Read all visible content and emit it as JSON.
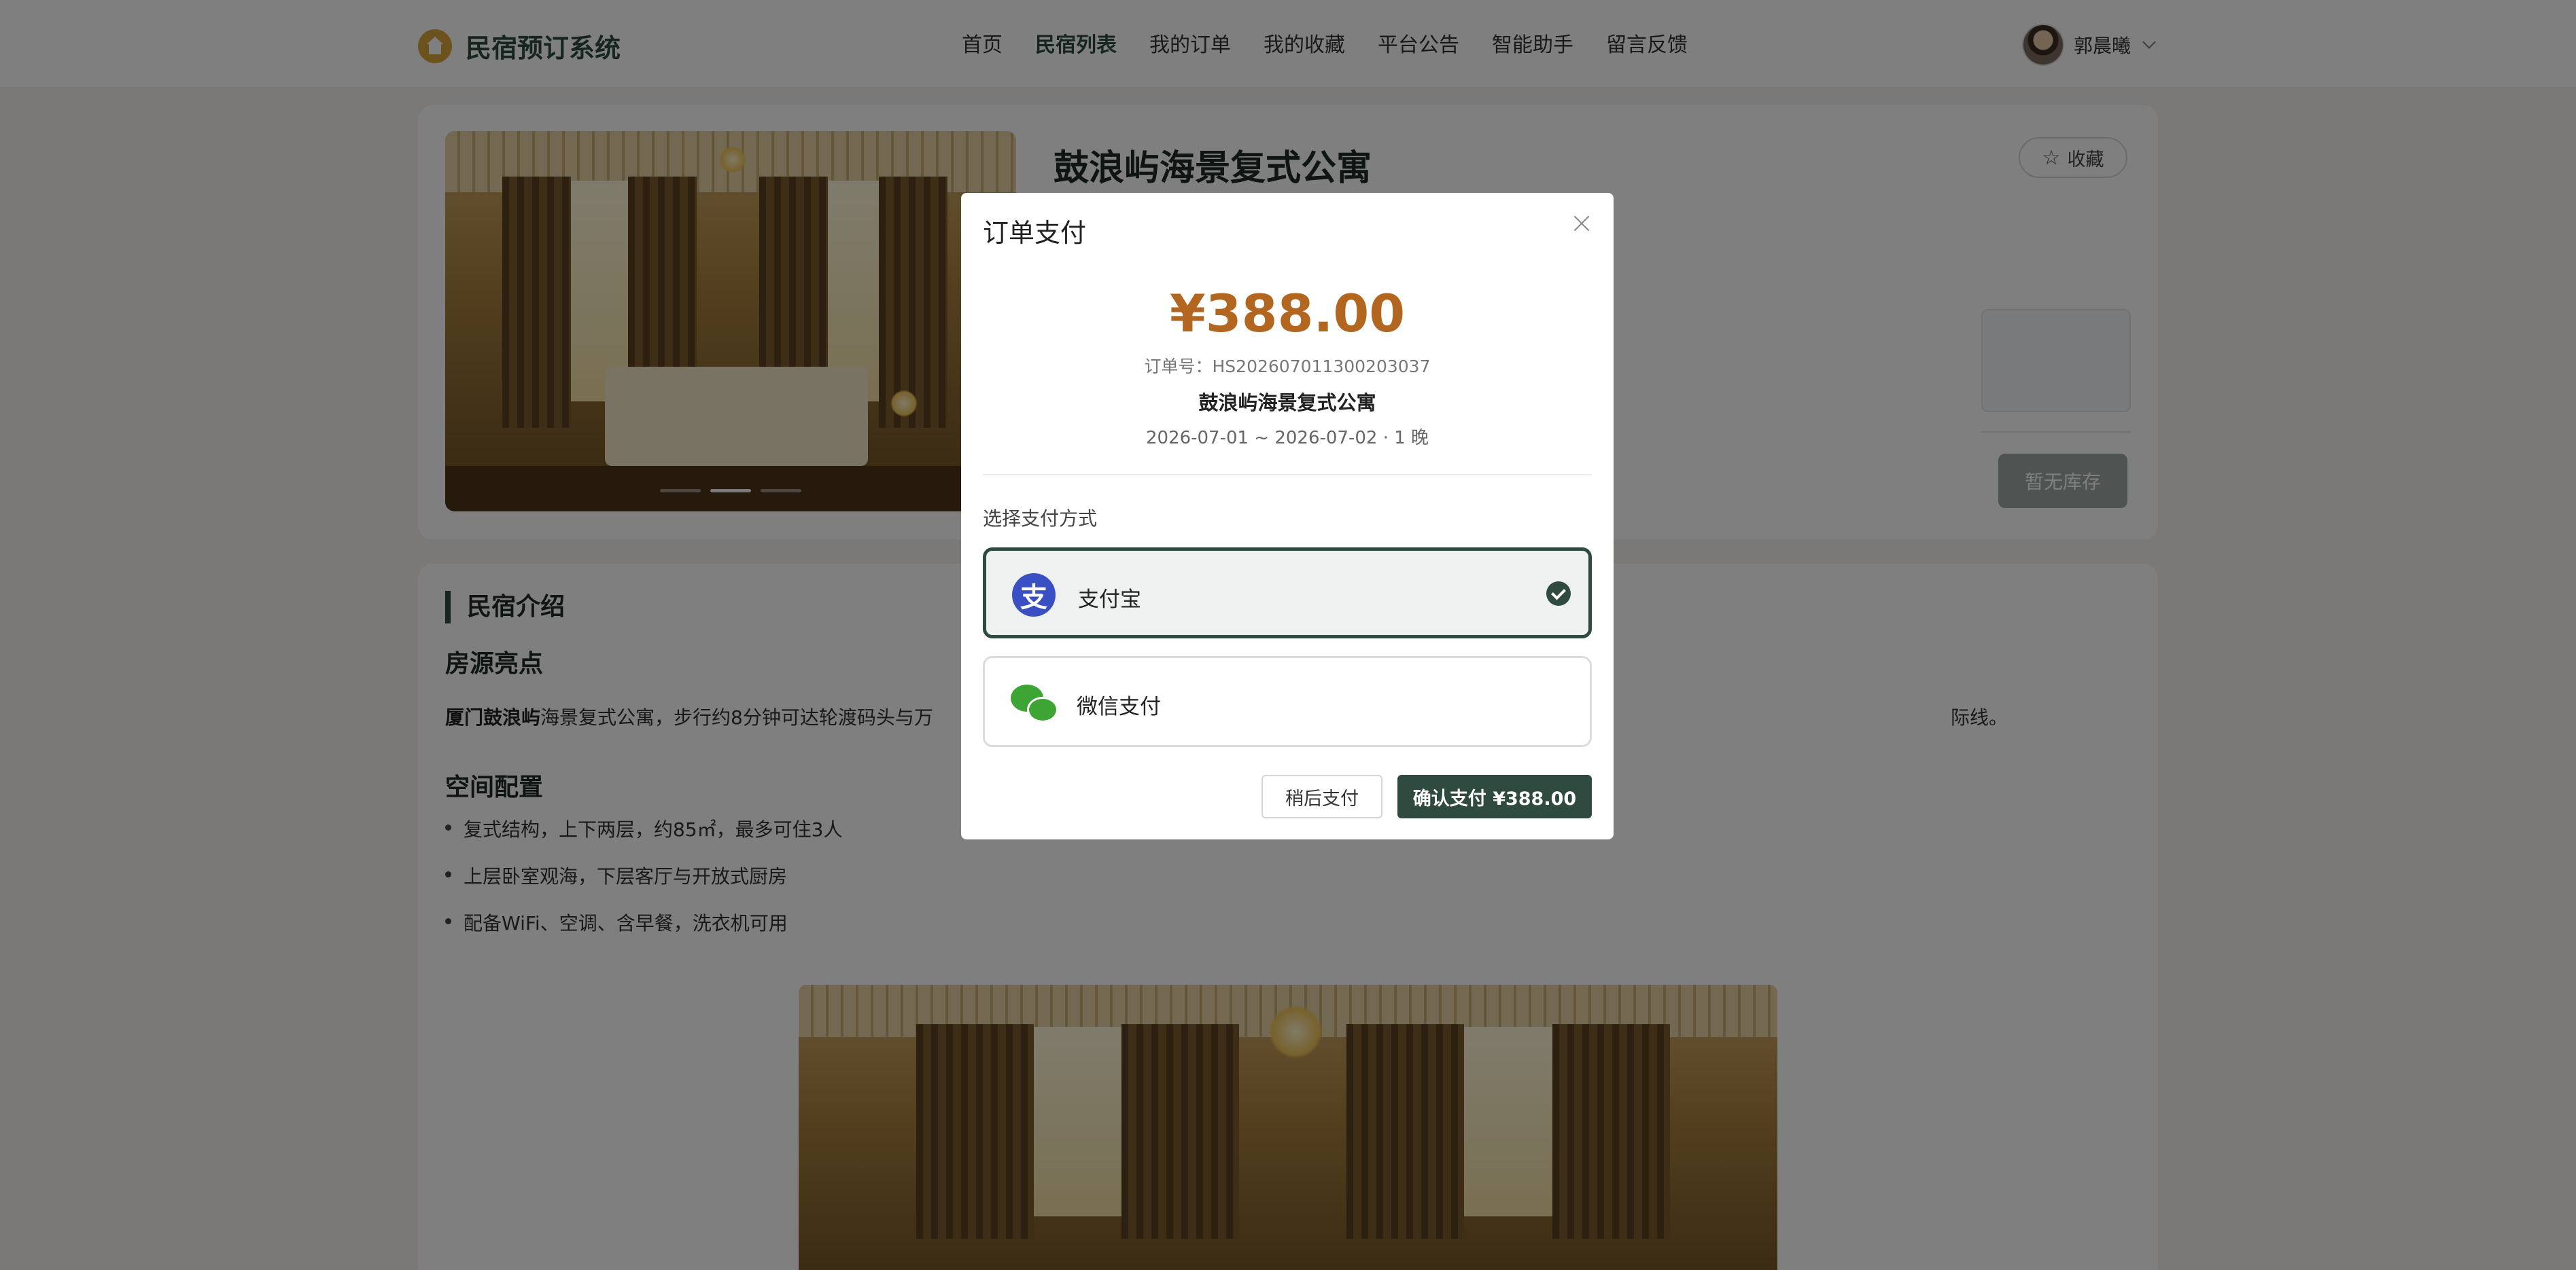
{
  "header": {
    "brand": "民宿预订系统",
    "nav": [
      "首页",
      "民宿列表",
      "我的订单",
      "我的收藏",
      "平台公告",
      "智能助手",
      "留言反馈"
    ],
    "active_nav": "民宿列表",
    "user_name": "郭晨曦"
  },
  "detail": {
    "title": "鼓浪屿海景复式公寓",
    "fav_label": "收藏",
    "stock_button": "暂无库存"
  },
  "intro": {
    "section_title": "民宿介绍",
    "highlight_title": "房源亮点",
    "para_bold": "厦门鼓浪屿",
    "para_rest": "海景复式公寓，步行约8分钟可达轮渡码头与万",
    "para_tail": "际线。",
    "space_title": "空间配置",
    "bullets": [
      "复式结构，上下两层，约85㎡，最多可住3人",
      "上层卧室观海，下层客厅与开放式厨房",
      "配备WiFi、空调、含早餐，洗衣机可用"
    ]
  },
  "modal": {
    "title": "订单支付",
    "amount": "¥388.00",
    "order_no": "订单号：HS202607011300203037",
    "room_name": "鼓浪屿海景复式公寓",
    "dates": "2026-07-01 ~ 2026-07-02 · 1 晚",
    "pay_label": "选择支付方式",
    "options": [
      {
        "label": "支付宝",
        "icon": "alipay-icon",
        "selected": true
      },
      {
        "label": "微信支付",
        "icon": "wechat-icon",
        "selected": false
      }
    ],
    "later_button": "稍后支付",
    "confirm_button": "确认支付 ¥388.00"
  },
  "colors": {
    "primary": "#2f4a3f",
    "amount": "#b3661f",
    "brand_logo": "#d9a43a",
    "alipay": "#3b4fc4",
    "wechat": "#3ea535"
  }
}
